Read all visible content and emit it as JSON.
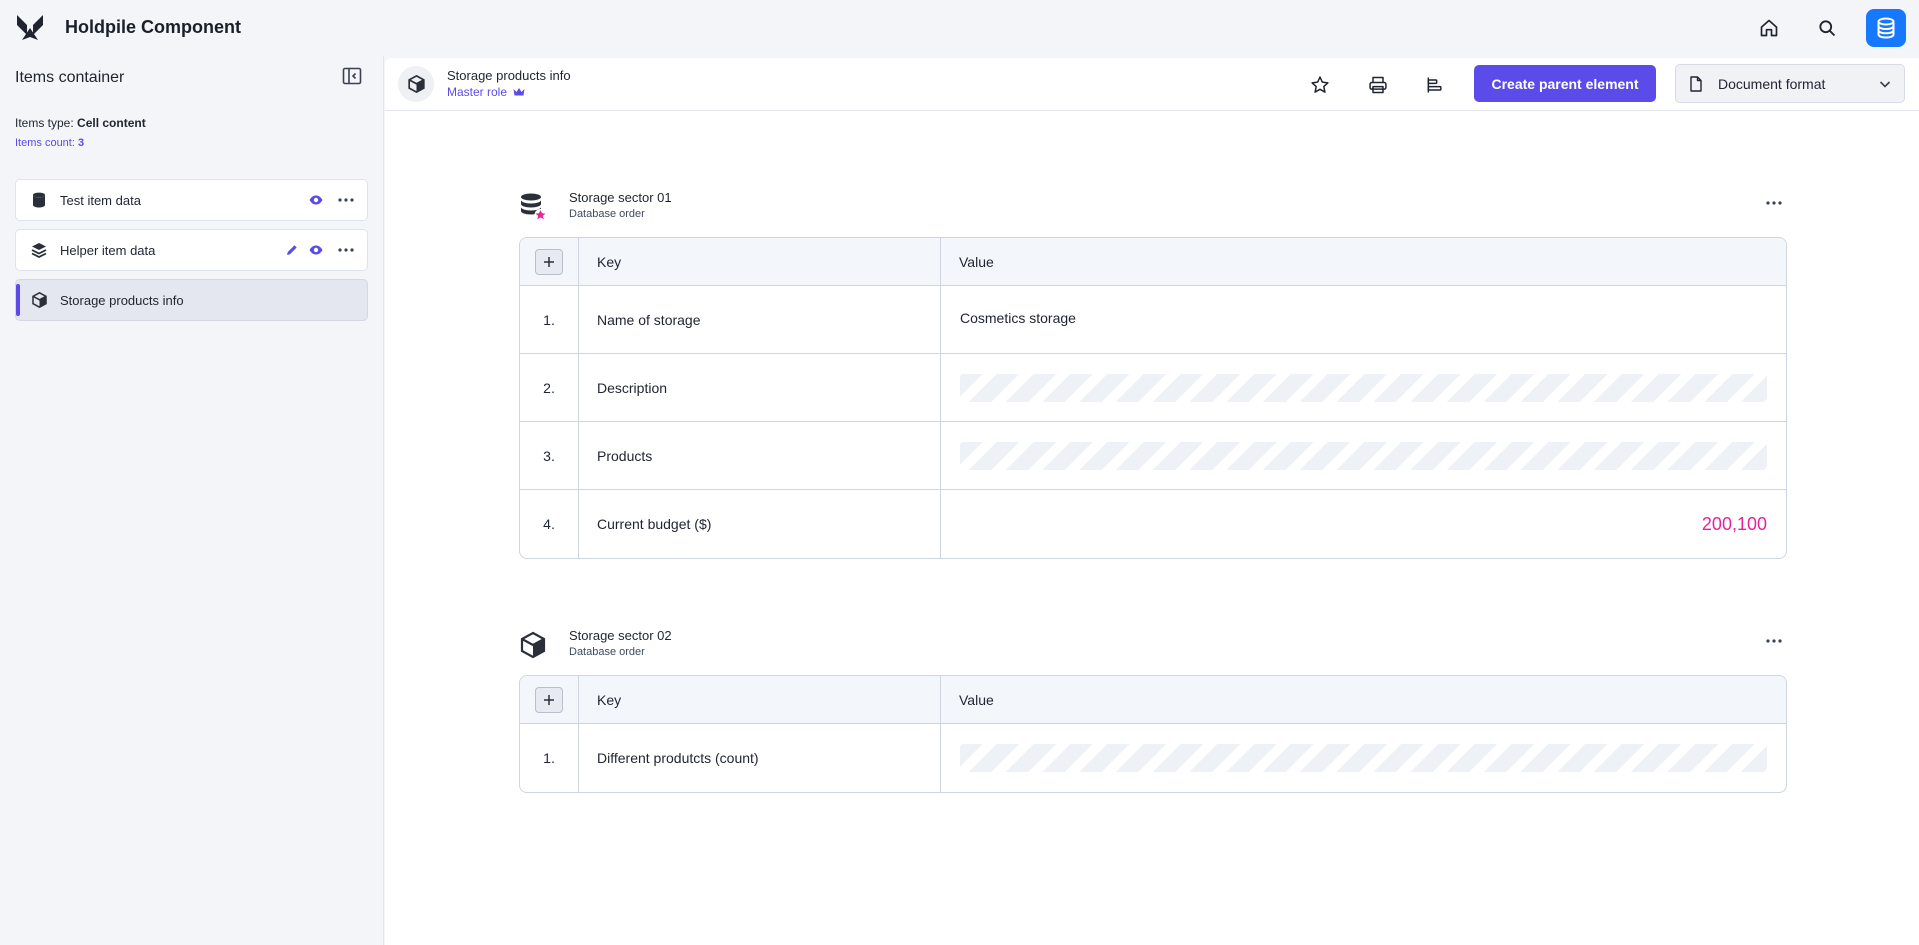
{
  "app": {
    "title": "Holdpile Component"
  },
  "sidebar": {
    "title": "Items container",
    "type_label": "Items type:",
    "type_value": "Cell content",
    "count_label": "Items count:",
    "count_value": "3",
    "items": [
      {
        "label": "Test item data",
        "icon": "database-icon"
      },
      {
        "label": "Helper item data",
        "icon": "layers-icon"
      },
      {
        "label": "Storage products info",
        "icon": "cube-icon"
      }
    ]
  },
  "header": {
    "title": "Storage products info",
    "role": "Master role",
    "create_button": "Create parent element",
    "format_select": "Document format"
  },
  "sections": [
    {
      "title": "Storage sector 01",
      "subtitle": "Database order",
      "col_key": "Key",
      "col_value": "Value",
      "rows": [
        {
          "num": "1.",
          "key": "Name of storage",
          "value": "Cosmetics storage"
        },
        {
          "num": "2.",
          "key": "Description",
          "value": ""
        },
        {
          "num": "3.",
          "key": "Products",
          "value": ""
        },
        {
          "num": "4.",
          "key": "Current budget ($)",
          "value": "200,100"
        }
      ]
    },
    {
      "title": "Storage sector 02",
      "subtitle": "Database order",
      "col_key": "Key",
      "col_value": "Value",
      "rows": [
        {
          "num": "1.",
          "key": "Different produtcts (count)",
          "value": ""
        }
      ]
    }
  ],
  "colors": {
    "accent": "#5b4be8",
    "brand_blue": "#1677ff",
    "highlight": "#e6239a"
  }
}
